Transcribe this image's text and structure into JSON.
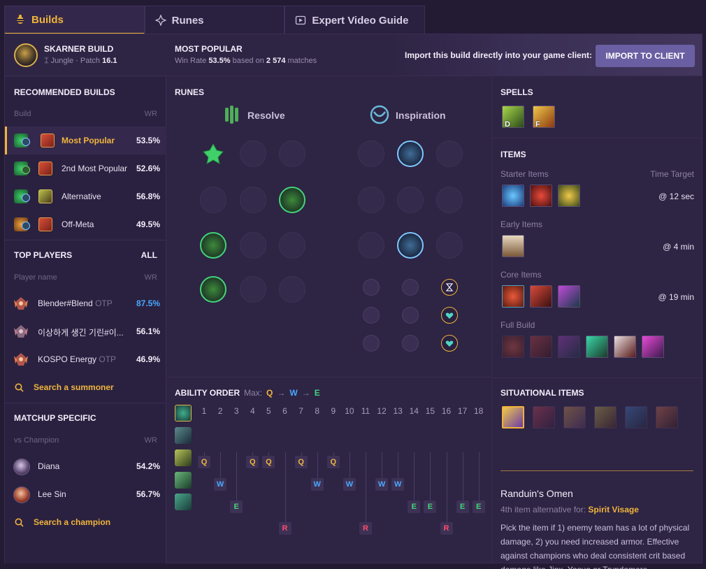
{
  "tabs": [
    {
      "label": "Builds",
      "icon": "bee-icon"
    },
    {
      "label": "Runes",
      "icon": "runes-icon"
    },
    {
      "label": "Expert Video Guide",
      "icon": "video-icon"
    }
  ],
  "header": {
    "champion": "SKARNER BUILD",
    "role": "Jungle",
    "patch_label": "Patch",
    "patch": "16.1",
    "popular_title": "MOST POPULAR",
    "win_rate_label": "Win Rate",
    "win_rate": "53.5%",
    "based_on_label": "based on",
    "matches": "2 574",
    "matches_label": "matches",
    "import_text": "Import this build directly into your game client:",
    "import_button": "IMPORT TO CLIENT"
  },
  "recommended": {
    "title": "RECOMMENDED BUILDS",
    "col_build": "Build",
    "col_wr": "WR",
    "builds": [
      {
        "name": "Most Popular",
        "wr": "53.5%"
      },
      {
        "name": "2nd Most Popular",
        "wr": "52.6%"
      },
      {
        "name": "Alternative",
        "wr": "56.8%"
      },
      {
        "name": "Off-Meta",
        "wr": "49.5%"
      }
    ]
  },
  "top_players": {
    "title": "TOP PLAYERS",
    "all": "ALL",
    "col_name": "Player name",
    "col_wr": "WR",
    "players": [
      {
        "name": "Blender#Blend",
        "tag": "OTP",
        "wr": "87.5%"
      },
      {
        "name": "이상하게 생긴 기린#이...",
        "tag": "",
        "wr": "56.1%"
      },
      {
        "name": "KOSPO Energy",
        "tag": "OTP",
        "wr": "46.9%"
      }
    ],
    "search": "Search a summoner"
  },
  "matchups": {
    "title": "MATCHUP SPECIFIC",
    "col_name": "vs Champion",
    "col_wr": "WR",
    "champions": [
      {
        "name": "Diana",
        "wr": "54.2%"
      },
      {
        "name": "Lee Sin",
        "wr": "56.7%"
      }
    ],
    "search": "Search a champion"
  },
  "runes": {
    "title": "RUNES",
    "primary": "Resolve",
    "secondary": "Inspiration"
  },
  "ability": {
    "title": "ABILITY ORDER",
    "max_label": "Max:",
    "max_order": [
      "Q",
      "W",
      "E"
    ],
    "levels": [
      "1",
      "2",
      "3",
      "4",
      "5",
      "6",
      "7",
      "8",
      "9",
      "10",
      "11",
      "12",
      "13",
      "14",
      "15",
      "16",
      "17",
      "18"
    ],
    "sequence": [
      "Q",
      "W",
      "E",
      "Q",
      "Q",
      "R",
      "Q",
      "W",
      "Q",
      "W",
      "R",
      "W",
      "W",
      "E",
      "E",
      "R",
      "E",
      "E"
    ]
  },
  "spells": {
    "title": "SPELLS",
    "keys": [
      "D",
      "F"
    ]
  },
  "items": {
    "title": "ITEMS",
    "starter_label": "Starter Items",
    "time_target_label": "Time Target",
    "starter_time": "@ 12 sec",
    "early_label": "Early Items",
    "early_time": "@ 4 min",
    "core_label": "Core Items",
    "core_time": "@ 19 min",
    "full_label": "Full Build"
  },
  "situational": {
    "title": "SITUATIONAL ITEMS",
    "item_name": "Randuin's Omen",
    "alt_prefix": "4th item alternative for:",
    "alt_for": "Spirit Visage",
    "description": "Pick the item if 1) enemy team has a lot of physical damage, 2) you need increased armor. Effective against champions who deal consistent crit based damage like Jinx, Yasuo or Tryndamere."
  },
  "colors": {
    "accent": "#f0b43c",
    "q": "#f0b43c",
    "w": "#4aa8ff",
    "e": "#45d479",
    "r": "#ff4d6a"
  }
}
